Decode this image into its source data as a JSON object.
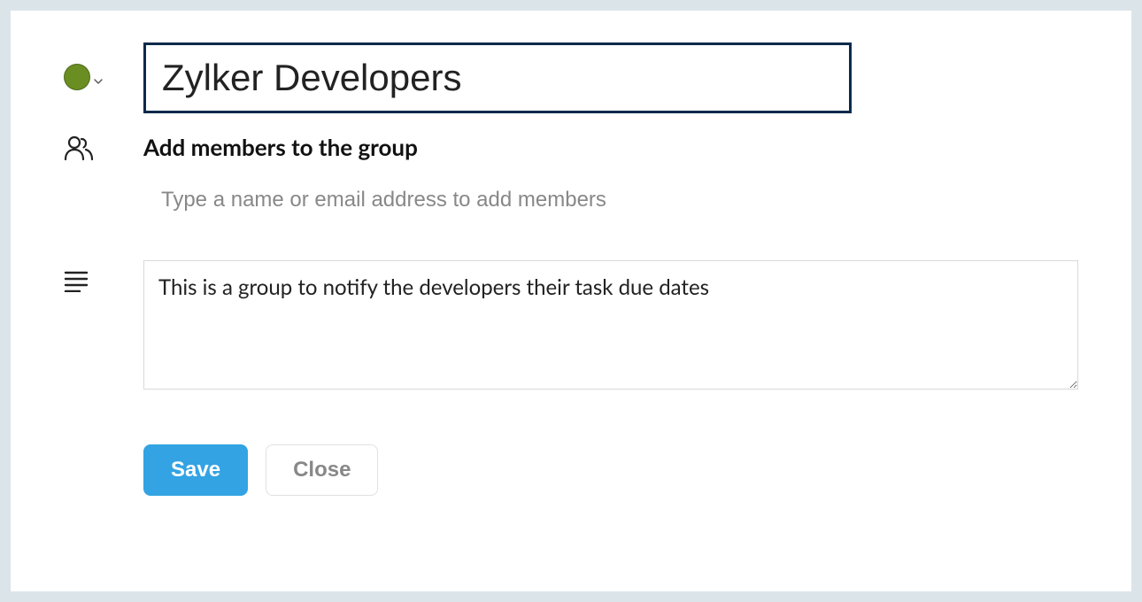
{
  "group": {
    "color": "#6b8e23",
    "name": "Zylker Developers"
  },
  "members": {
    "heading": "Add members to the group",
    "placeholder": "Type a name or email address to add members"
  },
  "description": {
    "value": "This is a group to notify the developers their task due dates"
  },
  "actions": {
    "save_label": "Save",
    "close_label": "Close"
  }
}
